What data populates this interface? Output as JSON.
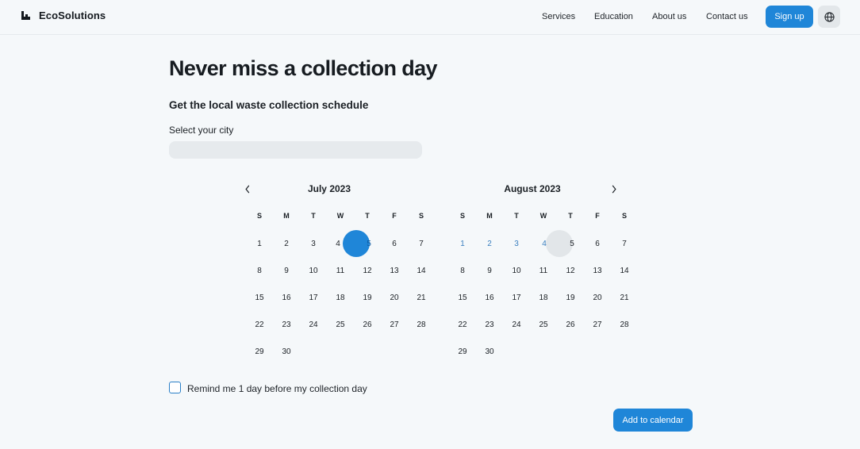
{
  "header": {
    "brand": "EcoSolutions",
    "nav": [
      "Services",
      "Education",
      "About us",
      "Contact us"
    ],
    "signup": "Sign up",
    "language_icon": "globe-icon"
  },
  "main": {
    "title": "Never miss a collection day",
    "subtitle": "Get the local waste collection schedule",
    "city_label": "Select your city",
    "city_value": ""
  },
  "calendar": {
    "weekdays": [
      "S",
      "M",
      "T",
      "W",
      "T",
      "F",
      "S"
    ],
    "prev_icon": "chevron-left-icon",
    "next_icon": "chevron-right-icon",
    "months": [
      {
        "title": "July 2023",
        "weeks": [
          [
            "1",
            "2",
            "3",
            "4",
            "5",
            "6",
            "7"
          ],
          [
            "8",
            "9",
            "10",
            "11",
            "12",
            "13",
            "14"
          ],
          [
            "15",
            "16",
            "17",
            "18",
            "19",
            "20",
            "21"
          ],
          [
            "22",
            "23",
            "24",
            "25",
            "26",
            "27",
            "28"
          ],
          [
            "29",
            "30"
          ]
        ],
        "selected_day": "5"
      },
      {
        "title": "August 2023",
        "weeks": [
          [
            "1",
            "2",
            "3",
            "4",
            "5",
            "6",
            "7"
          ],
          [
            "8",
            "9",
            "10",
            "11",
            "12",
            "13",
            "14"
          ],
          [
            "15",
            "16",
            "17",
            "18",
            "19",
            "20",
            "21"
          ],
          [
            "22",
            "23",
            "24",
            "25",
            "26",
            "27",
            "28"
          ],
          [
            "29",
            "30"
          ]
        ],
        "highlighted_days": [
          "1",
          "2",
          "3",
          "4"
        ],
        "hovered_day": "5"
      }
    ]
  },
  "reminder": {
    "label": "Remind me 1 day before my collection day",
    "checked": false
  },
  "actions": {
    "add_to_calendar": "Add to calendar"
  },
  "colors": {
    "accent": "#1f86d8",
    "background": "#f5f8fa",
    "highlight_text": "#3a7fbf"
  }
}
